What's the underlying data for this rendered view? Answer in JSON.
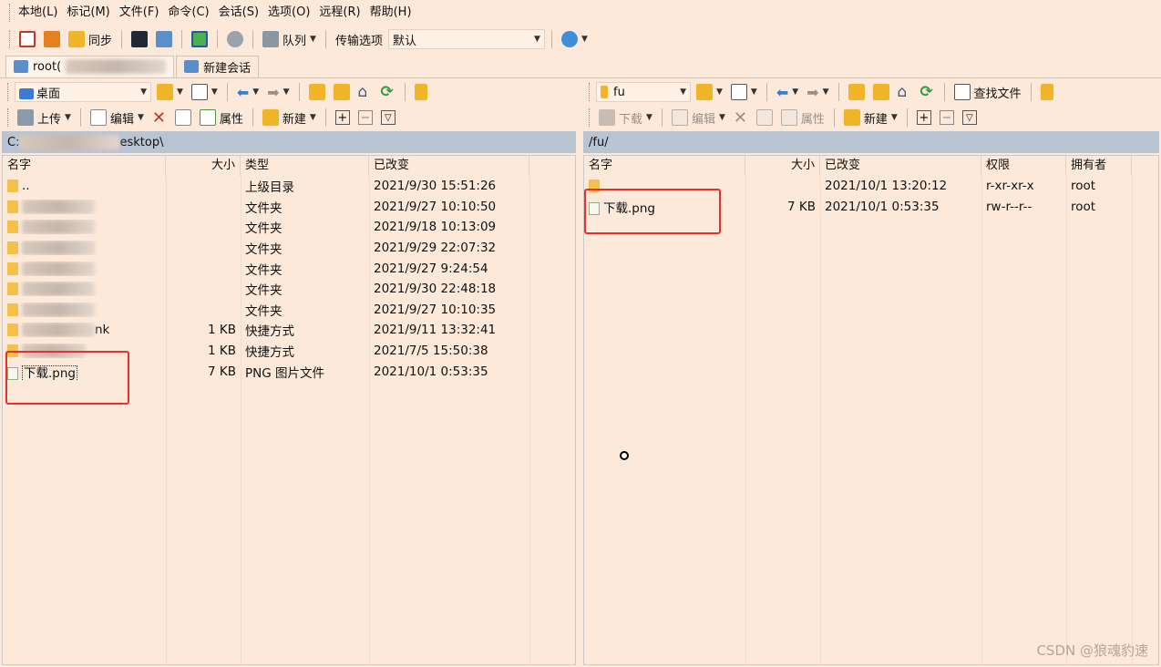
{
  "menu": [
    "本地(L)",
    "标记(M)",
    "文件(F)",
    "命令(C)",
    "会话(S)",
    "选项(O)",
    "远程(R)",
    "帮助(H)"
  ],
  "toolbar": {
    "sync_label": "同步",
    "queue_label": "队列",
    "transfer_label": "传输选项",
    "transfer_value": "默认"
  },
  "tabs": {
    "session_label": "root(",
    "new_session_label": "新建会话"
  },
  "left": {
    "location": "桌面",
    "upload_label": "上传",
    "edit_label": "编辑",
    "props_label": "属性",
    "new_label": "新建",
    "path_prefix": "C:",
    "path_suffix": "esktop\\",
    "headers": [
      "名字",
      "大小",
      "类型",
      "已改变"
    ],
    "rows": [
      {
        "name": "..",
        "size": "",
        "type": "上级目录",
        "changed": "2021/9/30  15:51:26"
      },
      {
        "name": "",
        "size": "",
        "type": "文件夹",
        "changed": "2021/9/27  10:10:50"
      },
      {
        "name": "",
        "size": "",
        "type": "文件夹",
        "changed": "2021/9/18  10:13:09"
      },
      {
        "name": "",
        "size": "",
        "type": "文件夹",
        "changed": "2021/9/29  22:07:32"
      },
      {
        "name": "",
        "size": "",
        "type": "文件夹",
        "changed": "2021/9/27  9:24:54"
      },
      {
        "name": "",
        "size": "",
        "type": "文件夹",
        "changed": "2021/9/30  22:48:18"
      },
      {
        "name": "",
        "size": "",
        "type": "文件夹",
        "changed": "2021/9/27  10:10:35"
      },
      {
        "name": "nk",
        "size": "1 KB",
        "type": "快捷方式",
        "changed": "2021/9/11  13:32:41"
      },
      {
        "name": "",
        "size": "1 KB",
        "type": "快捷方式",
        "changed": "2021/7/5  15:50:38"
      },
      {
        "name": "下载.png",
        "size": "7 KB",
        "type": "PNG 图片文件",
        "changed": "2021/10/1  0:53:35"
      }
    ]
  },
  "right": {
    "location": "fu",
    "download_label": "下载",
    "edit_label": "编辑",
    "props_label": "属性",
    "new_label": "新建",
    "find_label": "查找文件",
    "path": "/fu/",
    "headers": [
      "名字",
      "大小",
      "已改变",
      "权限",
      "拥有者"
    ],
    "rows": [
      {
        "name": "",
        "size": "",
        "changed": "2021/10/1 13:20:12",
        "perm": "r-xr-xr-x",
        "owner": "root"
      },
      {
        "name": "下载.png",
        "size": "7 KB",
        "changed": "2021/10/1 0:53:35",
        "perm": "rw-r--r--",
        "owner": "root"
      }
    ]
  },
  "watermark": "CSDN @狼魂豹速"
}
